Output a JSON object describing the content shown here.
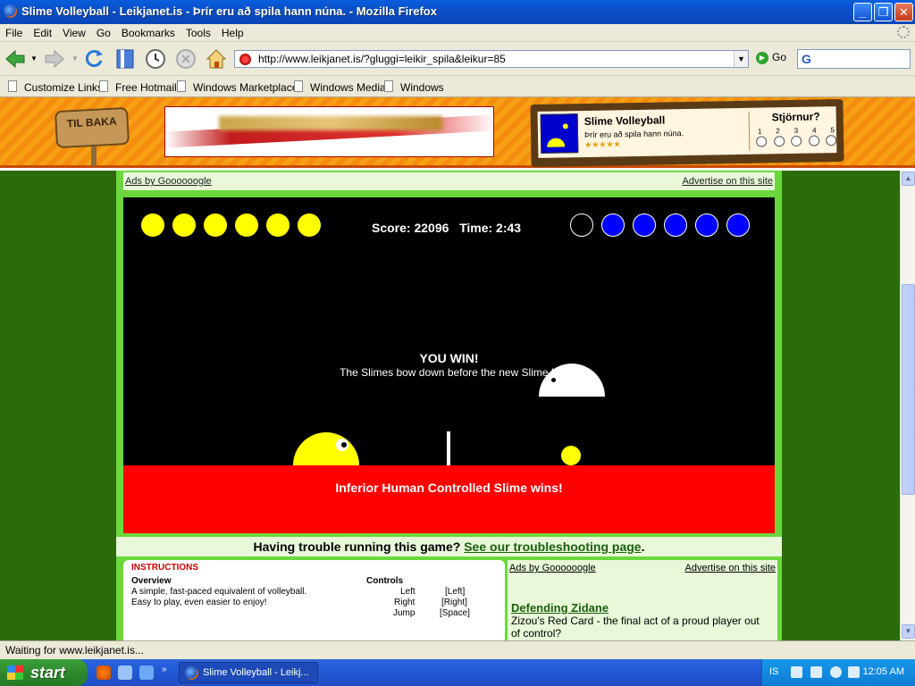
{
  "window": {
    "title": "Slime Volleyball - Leikjanet.is - Þrír eru að spila hann núna. - Mozilla Firefox"
  },
  "menu": [
    "File",
    "Edit",
    "View",
    "Go",
    "Bookmarks",
    "Tools",
    "Help"
  ],
  "nav": {
    "url": "http://www.leikjanet.is/?gluggi=leikir_spila&leikur=85",
    "go_label": "Go",
    "search_logo": "G"
  },
  "bookmarks": [
    "Customize Links",
    "Free Hotmail",
    "Windows Marketplace",
    "Windows Media",
    "Windows"
  ],
  "site": {
    "back_sign": "TIL BAKA",
    "game_name": "Slime Volleyball",
    "game_desc": "Þrír eru að spila hann núna.",
    "stars": "★★★★★",
    "vote_label": "Stjörnur?",
    "vote_options": [
      "1",
      "2",
      "3",
      "4",
      "5"
    ]
  },
  "ads_top": {
    "left": "Ads by Goooooogle",
    "right": "Advertise on this site"
  },
  "game": {
    "score_text": "Score: 22096",
    "time_text": "Time: 2:43",
    "win_title": "YOU WIN!",
    "win_sub": "The Slimes bow down before the new Slime K",
    "banner": "Inferior Human Controlled Slime wins!",
    "left_points": 6,
    "right_points": 5,
    "points_total": 6,
    "colors": {
      "left": "#ffff00",
      "right": "#0000ff",
      "ground": "#ff0000",
      "sky": "#000000"
    }
  },
  "trouble": {
    "text": "Having trouble running this game?",
    "link": "See our troubleshooting page",
    "end": "."
  },
  "instructions": {
    "heading": "INSTRUCTIONS",
    "overview_h": "Overview",
    "overview_1": "A simple, fast-paced equivalent of volleyball.",
    "overview_2": "Easy to play, even easier to enjoy!",
    "controls_h": "Controls",
    "controls": [
      {
        "action": "Left",
        "key": "[Left]"
      },
      {
        "action": "Right",
        "key": "[Right]"
      },
      {
        "action": "Jump",
        "key": "[Space]"
      }
    ]
  },
  "ads_side": {
    "left": "Ads by Goooooogle",
    "right": "Advertise on this site",
    "ad_title": "Defending Zidane",
    "ad_text": "Zizou's Red Card - the final act of a proud player out of control?"
  },
  "status": "Waiting for www.leikjanet.is...",
  "taskbar": {
    "start": "start",
    "item": "Slime Volleyball - Leikj...",
    "lang": "IS",
    "time": "12:05 AM"
  }
}
